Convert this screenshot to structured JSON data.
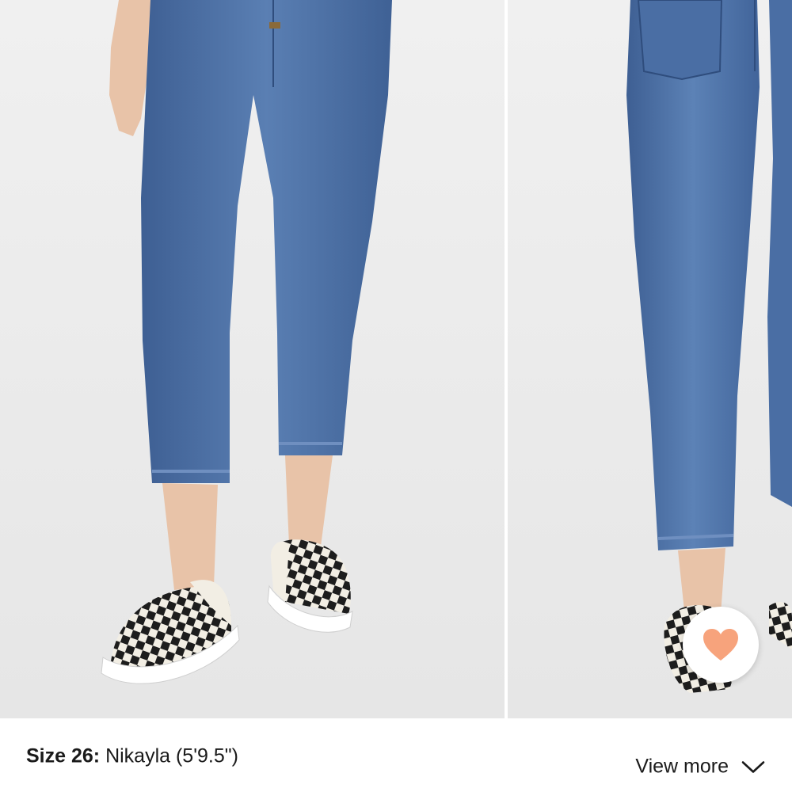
{
  "gallery": {
    "images": [
      {
        "icon": "model-front-view-photo"
      },
      {
        "icon": "model-back-view-photo"
      }
    ],
    "favorite": {
      "icon": "heart-icon",
      "color": "#F7A37C"
    }
  },
  "size_info": {
    "label": "Size 26:",
    "model": "Nikayla (5'9.5\")"
  },
  "view_more": {
    "label": "View more",
    "icon": "chevron-down-icon"
  },
  "colors": {
    "background": "#ffffff",
    "photo_backdrop": "#ededed",
    "denim": "#4f72a6",
    "heart": "#F7A37C",
    "text": "#1a1a1a"
  }
}
